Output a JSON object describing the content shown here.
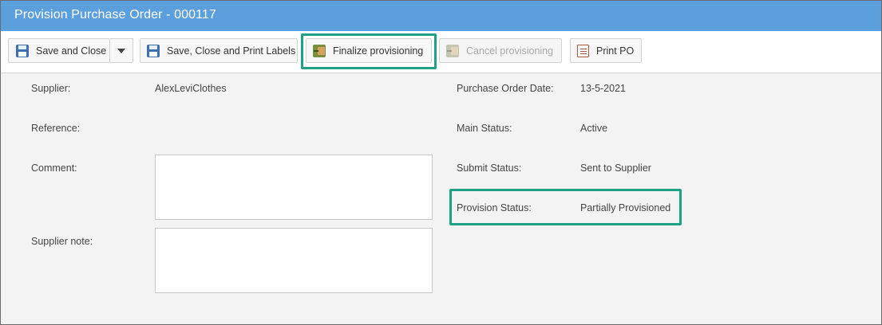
{
  "window": {
    "title": "Provision Purchase Order - 000117"
  },
  "toolbar": {
    "save_close": {
      "label": "Save and Close",
      "icon": "floppy-disk-icon"
    },
    "save_close_print": {
      "label": "Save, Close and Print Labels",
      "icon": "floppy-disk-icon"
    },
    "finalize": {
      "label": "Finalize provisioning",
      "icon": "finalize-icon"
    },
    "cancel": {
      "label": "Cancel provisioning",
      "icon": "cancel-provisioning-icon",
      "disabled": true
    },
    "print_po": {
      "label": "Print PO",
      "icon": "document-print-icon"
    }
  },
  "form": {
    "supplier": {
      "label": "Supplier:",
      "value": "AlexLeviClothes"
    },
    "reference": {
      "label": "Reference:",
      "value": ""
    },
    "comment": {
      "label": "Comment:",
      "value": ""
    },
    "supplier_note": {
      "label": "Supplier note:",
      "value": ""
    },
    "po_date": {
      "label": "Purchase Order Date:",
      "value": "13-5-2021"
    },
    "main_status": {
      "label": "Main Status:",
      "value": "Active"
    },
    "submit_status": {
      "label": "Submit Status:",
      "value": "Sent to Supplier"
    },
    "provision_status": {
      "label": "Provision Status:",
      "value": "Partially Provisioned"
    }
  },
  "colors": {
    "title_bar": "#5b9fdc",
    "highlight": "#1ea284",
    "background": "#f3f3f3"
  }
}
